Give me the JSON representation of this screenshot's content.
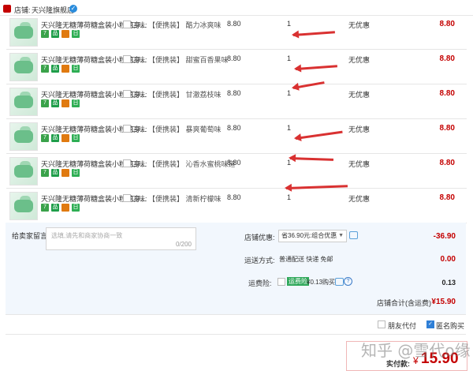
{
  "shop": {
    "label": "店铺:",
    "name": "天兴隆旗舰店"
  },
  "items": [
    {
      "title": "天兴隆无糖薄荷糖盒装小粒随身...",
      "flavor_label": "口味:",
      "flavor": "【便携装】 酷力冰爽味",
      "price": "8.80",
      "qty": "1",
      "discount": "无优惠",
      "subtotal": "8.80"
    },
    {
      "title": "天兴隆无糖薄荷糖盒装小粒随身...",
      "flavor_label": "口味:",
      "flavor": "【便携装】 甜蜜百香果味",
      "price": "8.80",
      "qty": "1",
      "discount": "无优惠",
      "subtotal": "8.80"
    },
    {
      "title": "天兴隆无糖薄荷糖盒装小粒随身...",
      "flavor_label": "口味:",
      "flavor": "【便携装】 甘澈荔枝味",
      "price": "8.80",
      "qty": "1",
      "discount": "无优惠",
      "subtotal": "8.80"
    },
    {
      "title": "天兴隆无糖薄荷糖盒装小粒随身...",
      "flavor_label": "口味:",
      "flavor": "【便携装】 暴爽葡萄味",
      "price": "8.80",
      "qty": "1",
      "discount": "无优惠",
      "subtotal": "8.80"
    },
    {
      "title": "天兴隆无糖薄荷糖盒装小粒随身...",
      "flavor_label": "口味:",
      "flavor": "【便携装】 沁香水蜜桃味道",
      "price": "8.80",
      "qty": "1",
      "discount": "无优惠",
      "subtotal": "8.80"
    },
    {
      "title": "天兴隆无糖薄荷糖盒装小粒随身...",
      "flavor_label": "口味:",
      "flavor": "【便携装】 清新柠檬味",
      "price": "8.80",
      "qty": "1",
      "discount": "无优惠",
      "subtotal": "8.80"
    }
  ],
  "badges": [
    "7",
    "品",
    "",
    "日"
  ],
  "message": {
    "label": "给卖家留言:",
    "placeholder": "选填,请先和商家协商一致",
    "counter": "0/200"
  },
  "shop_discount": {
    "label": "店铺优惠:",
    "selected": "省36.90元:组合优惠",
    "amount": "-36.90"
  },
  "shipping": {
    "label": "运送方式:",
    "method": "普通配送 快递 免邮",
    "amount": "0.00"
  },
  "insurance": {
    "label": "运费险:",
    "tag": "运费险",
    "price": "¥0.13购买",
    "help": "?",
    "amount": "0.13"
  },
  "total": {
    "label": "店铺合计(含运费)",
    "value": "¥15.90"
  },
  "options": {
    "friend_pay": "朋友代付",
    "anonymous": "匿名购买"
  },
  "payment": {
    "label": "实付款:",
    "currency": "¥",
    "value": "15.90"
  },
  "watermark": "知乎 @雪代o缘",
  "colors": {
    "price_red": "#c40000",
    "arrow_red": "#d93131",
    "tag_green": "#2fa85a"
  }
}
